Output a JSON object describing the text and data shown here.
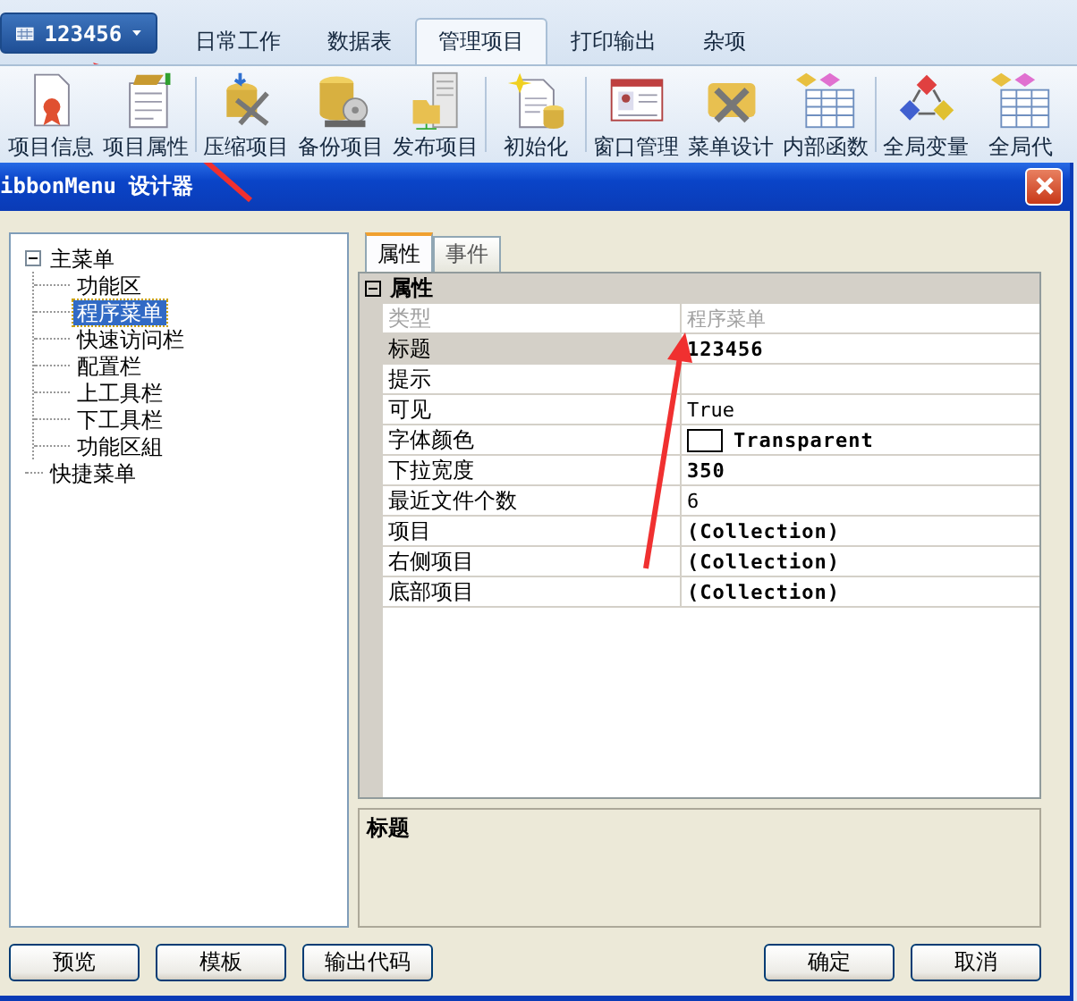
{
  "app_menu": {
    "label": "123456"
  },
  "tabs": [
    {
      "label": "日常工作",
      "selected": false
    },
    {
      "label": "数据表",
      "selected": false
    },
    {
      "label": "管理项目",
      "selected": true
    },
    {
      "label": "打印输出",
      "selected": false
    },
    {
      "label": "杂项",
      "selected": false
    }
  ],
  "ribbon": {
    "groups": [
      {
        "buttons": [
          {
            "label": "项目信息"
          },
          {
            "label": "项目属性"
          }
        ]
      },
      {
        "buttons": [
          {
            "label": "压缩项目"
          },
          {
            "label": "备份项目"
          },
          {
            "label": "发布项目"
          }
        ]
      },
      {
        "buttons": [
          {
            "label": "初始化"
          }
        ]
      },
      {
        "buttons": [
          {
            "label": "窗口管理"
          },
          {
            "label": "菜单设计"
          },
          {
            "label": "内部函数"
          }
        ]
      },
      {
        "buttons": [
          {
            "label": "全局变量"
          },
          {
            "label": "全局代"
          }
        ]
      }
    ]
  },
  "dialog": {
    "title": "ibbonMenu 设计器",
    "tree": [
      {
        "label": "主菜单",
        "expanded": true,
        "selected": false,
        "children": [
          {
            "label": "功能区",
            "selected": false
          },
          {
            "label": "程序菜单",
            "selected": true
          },
          {
            "label": "快速访问栏",
            "selected": false
          },
          {
            "label": "配置栏",
            "selected": false
          },
          {
            "label": "上工具栏",
            "selected": false
          },
          {
            "label": "下工具栏",
            "selected": false
          },
          {
            "label": "功能区組",
            "selected": false
          }
        ]
      },
      {
        "label": "快捷菜单",
        "selected": false
      }
    ],
    "panel_tabs": [
      {
        "label": "属性",
        "selected": true
      },
      {
        "label": "事件",
        "selected": false
      }
    ],
    "property_grid": {
      "category": "属性",
      "expanded": true,
      "rows": [
        {
          "kind": "text",
          "name": "类型",
          "value": "程序菜单",
          "disabled": true,
          "bold": false,
          "selected": false
        },
        {
          "kind": "text",
          "name": "标题",
          "value": "123456",
          "disabled": false,
          "bold": true,
          "selected": true
        },
        {
          "kind": "text",
          "name": "提示",
          "disabled": false,
          "selected": false
        },
        {
          "kind": "text",
          "name": "可见",
          "value": "True",
          "disabled": false,
          "bold": false,
          "selected": false
        },
        {
          "kind": "color",
          "name": "字体颜色",
          "value": "Transparent",
          "disabled": false,
          "bold": true,
          "selected": false
        },
        {
          "kind": "text",
          "name": "下拉宽度",
          "value": "350",
          "disabled": false,
          "bold": true,
          "selected": false
        },
        {
          "kind": "text",
          "name": "最近文件个数",
          "value": "6",
          "disabled": false,
          "bold": false,
          "selected": false
        },
        {
          "kind": "text",
          "name": "项目",
          "value": "(Collection)",
          "disabled": false,
          "bold": true,
          "selected": false
        },
        {
          "kind": "text",
          "name": "右侧项目",
          "value": "(Collection)",
          "disabled": false,
          "bold": true,
          "selected": false
        },
        {
          "kind": "text",
          "name": "底部项目",
          "value": "(Collection)",
          "disabled": false,
          "bold": true,
          "selected": false
        }
      ]
    },
    "description": {
      "title": "标题"
    },
    "buttons_left": [
      "预览",
      "模板",
      "输出代码"
    ],
    "buttons_right": [
      "确定",
      "取消"
    ]
  }
}
